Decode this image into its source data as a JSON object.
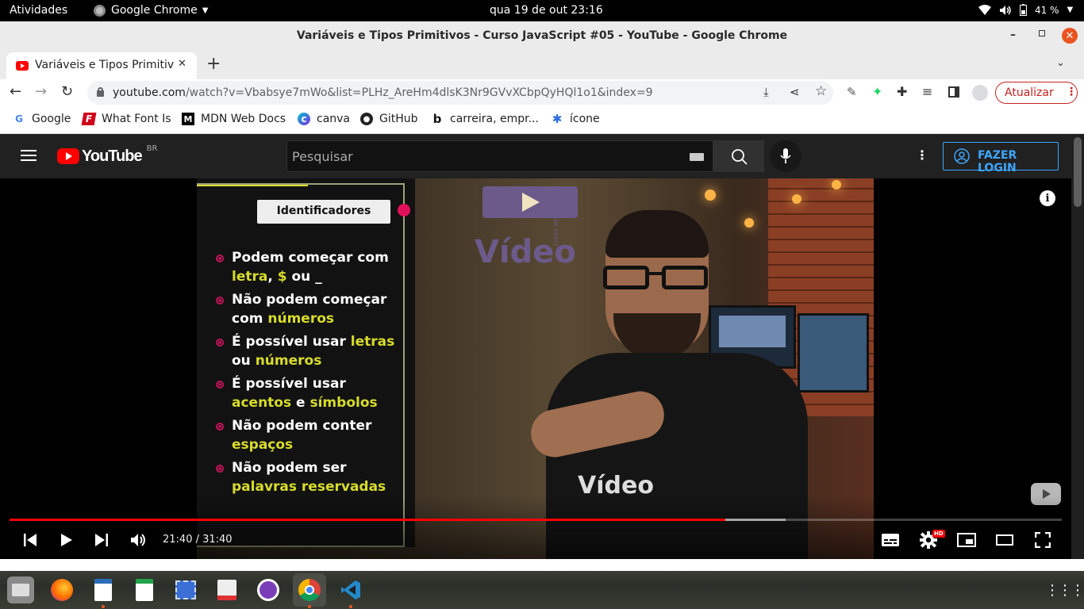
{
  "topbar": {
    "activities": "Atividades",
    "app_name": "Google Chrome",
    "clock": "qua 19 de out  23:16",
    "battery": "41 %"
  },
  "window": {
    "title": "Variáveis e Tipos Primitivos - Curso JavaScript #05 - YouTube - Google Chrome"
  },
  "tab": {
    "title": "Variáveis e Tipos Primitivos - Curso JavaScript #05 - YouTube"
  },
  "toolbar": {
    "url_domain": "youtube.com",
    "url_path": "/watch?v=Vbabsye7mWo&list=PLHz_AreHm4dlsK3Nr9GVvXCbpQyHQl1o1&index=9",
    "update_label": "Atualizar"
  },
  "bookmarks": [
    {
      "label": "Google",
      "icon": "google-icon"
    },
    {
      "label": "What Font Is",
      "icon": "whatfontis-icon"
    },
    {
      "label": "MDN Web Docs",
      "icon": "mdn-icon"
    },
    {
      "label": "canva",
      "icon": "canva-icon"
    },
    {
      "label": "GitHub",
      "icon": "github-icon"
    },
    {
      "label": "carreira, empr...",
      "icon": "b-icon"
    },
    {
      "label": "ícone",
      "icon": "icone-icon"
    }
  ],
  "youtube": {
    "logo_text": "YouTube",
    "region": "BR",
    "search_placeholder": "Pesquisar",
    "login_label": "FAZER LOGIN"
  },
  "slide": {
    "heading": "Identificadores",
    "items": [
      {
        "l1": "Podem começar com",
        "l2a": "letra",
        "l2b": ", ",
        "l2c": "$",
        "l2d": " ou _"
      },
      {
        "l1": "Não podem começar",
        "l2a": "com ",
        "l2b": "números"
      },
      {
        "l1a": "É possível usar ",
        "l1b": "letras",
        "l2a": "ou ",
        "l2b": "números"
      },
      {
        "l1": "É possível usar",
        "l2a": "acentos",
        "l2b": " e ",
        "l2c": "símbolos"
      },
      {
        "l1": "Não podem conter",
        "l2": "espaços"
      },
      {
        "l1": "Não podem ser",
        "l2": "palavras reservadas"
      }
    ],
    "logo_text": "Vídeo",
    "logo_small": "curso em",
    "shirt_text": "Vídeo"
  },
  "player": {
    "time": "21:40 / 31:40",
    "progress": 0.6803,
    "buffered": 0.7374,
    "hd_badge": "HD"
  },
  "colors": {
    "progress": "#ff0000",
    "youtube_red": "#ff0000",
    "accent_yellow": "#d7dc29",
    "bullet": "#c0145a",
    "login_blue": "#3ea6ff",
    "update_red": "#c5221f"
  }
}
